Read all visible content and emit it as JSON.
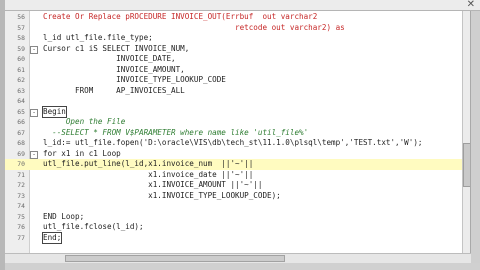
{
  "editor": {
    "lines": [
      {
        "n": "56",
        "text": "Create Or Replace pROCEDURE INVOICE_OUT(Errbuf  out varchar2",
        "kind": "kw"
      },
      {
        "n": "57",
        "text": "                                          retcode out varchar2) as",
        "kind": "kw"
      },
      {
        "n": "58",
        "text": "l_id utl_file.file_type;",
        "kind": "code"
      },
      {
        "n": "59",
        "text": "Cursor c1 iS SELECT INVOICE_NUM,",
        "kind": "code"
      },
      {
        "n": "60",
        "text": "                INVOICE_DATE,",
        "kind": "code"
      },
      {
        "n": "61",
        "text": "                INVOICE_AMOUNT,",
        "kind": "code"
      },
      {
        "n": "62",
        "text": "                INVOICE_TYPE_LOOKUP_CODE",
        "kind": "code"
      },
      {
        "n": "63",
        "text": "       FROM     AP_INVOICES_ALL",
        "kind": "code"
      },
      {
        "n": "64",
        "text": "",
        "kind": "code"
      },
      {
        "n": "65",
        "text": "Begin",
        "kind": "box"
      },
      {
        "n": "66",
        "text": "     Open the File",
        "kind": "comment"
      },
      {
        "n": "67",
        "text": "  --SELECT * FROM V$PARAMETER where name like 'util_file%'",
        "kind": "comment"
      },
      {
        "n": "68",
        "text": "l_id:= utl_file.fopen('D:\\oracle\\VIS\\db\\tech_st\\11.1.0\\plsql\\temp','TEST.txt','W');",
        "kind": "code"
      },
      {
        "n": "69",
        "text": "for x1 in c1 Loop",
        "kind": "loop"
      },
      {
        "n": "70",
        "text": "utl_file.put_line(l_id,x1.invoice_num  ||'~'||",
        "kind": "active"
      },
      {
        "n": "71",
        "text": "                       x1.invoice_date ||'~'||",
        "kind": "code"
      },
      {
        "n": "72",
        "text": "                       x1.INVOICE_AMOUNT ||'~'||",
        "kind": "code"
      },
      {
        "n": "73",
        "text": "                       x1.INVOICE_TYPE_LOOKUP_CODE);",
        "kind": "code"
      },
      {
        "n": "74",
        "text": "",
        "kind": "code"
      },
      {
        "n": "75",
        "text": "END Loop;",
        "kind": "code"
      },
      {
        "n": "76",
        "text": "utl_file.fclose(l_id);",
        "kind": "code"
      },
      {
        "n": "77",
        "text": "End;",
        "kind": "box"
      }
    ]
  },
  "icons": {
    "close": "✕"
  },
  "colors": {
    "keyword": "#c62828",
    "comment": "#2e7d32",
    "current_line": "#fffbc0",
    "selection": "#b9cbe9"
  }
}
